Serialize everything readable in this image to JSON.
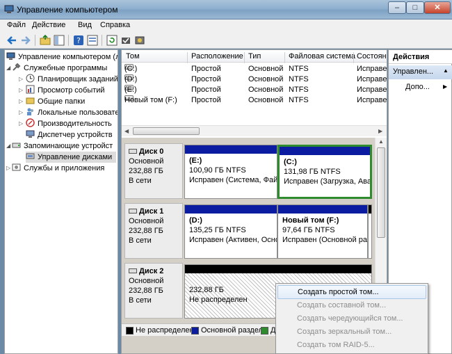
{
  "window": {
    "title": "Управление компьютером"
  },
  "menu": [
    "Файл",
    "Действие",
    "Вид",
    "Справка"
  ],
  "tree": [
    {
      "label": "Управление компьютером (л",
      "level": 0
    },
    {
      "label": "Служебные программы",
      "level": 1
    },
    {
      "label": "Планировщик заданий",
      "level": 2
    },
    {
      "label": "Просмотр событий",
      "level": 2
    },
    {
      "label": "Общие папки",
      "level": 2
    },
    {
      "label": "Локальные пользовате",
      "level": 2
    },
    {
      "label": "Производительность",
      "level": 2
    },
    {
      "label": "Диспетчер устройств",
      "level": 2
    },
    {
      "label": "Запоминающие устройст",
      "level": 1
    },
    {
      "label": "Управление дисками",
      "level": 2
    },
    {
      "label": "Службы и приложения",
      "level": 1
    }
  ],
  "volumes": {
    "headers": [
      "Том",
      "Расположение",
      "Тип",
      "Файловая система",
      "Состоян"
    ],
    "rows": [
      [
        "(C:)",
        "Простой",
        "Основной",
        "NTFS",
        "Исправе"
      ],
      [
        "(D:)",
        "Простой",
        "Основной",
        "NTFS",
        "Исправе"
      ],
      [
        "(E:)",
        "Простой",
        "Основной",
        "NTFS",
        "Исправе"
      ],
      [
        "Новый том (F:)",
        "Простой",
        "Основной",
        "NTFS",
        "Исправе"
      ]
    ]
  },
  "disks": [
    {
      "name": "Диск 0",
      "type": "Основной",
      "size": "232,88 ГБ",
      "status": "В сети",
      "partitions": [
        {
          "name": "(E:)",
          "size": "100,90 ГБ NTFS",
          "status": "Исправен (Система, Фай"
        },
        {
          "name": "(C:)",
          "size": "131,98 ГБ NTFS",
          "status": "Исправен (Загрузка, Ава"
        }
      ]
    },
    {
      "name": "Диск 1",
      "type": "Основной",
      "size": "232,88 ГБ",
      "status": "В сети",
      "partitions": [
        {
          "name": "(D:)",
          "size": "135,25 ГБ NTFS",
          "status": "Исправен (Активен, Осно"
        },
        {
          "name": "Новый том  (F:)",
          "size": "97,64 ГБ NTFS",
          "status": "Исправен (Основной ра"
        }
      ]
    },
    {
      "name": "Диск 2",
      "type": "Основной",
      "size": "232,88 ГБ",
      "status": "В сети",
      "partitions": [
        {
          "name": "232,88 ГБ",
          "size": "",
          "status": "Не распределен"
        }
      ]
    }
  ],
  "legend": [
    {
      "label": "Не распределен",
      "color": "#000000"
    },
    {
      "label": "Основной раздел",
      "color": "#0b1ca1"
    },
    {
      "label": "Д",
      "color": "#2e8b2e"
    }
  ],
  "actions": {
    "title": "Действия",
    "section": "Управлен...",
    "more": "Допо..."
  },
  "context_menu": [
    {
      "label": "Создать простой том...",
      "enabled": true
    },
    {
      "label": "Создать составной том...",
      "enabled": false
    },
    {
      "label": "Создать чередующийся том...",
      "enabled": false
    },
    {
      "label": "Создать зеркальный том...",
      "enabled": false
    },
    {
      "label": "Создать том RAID-5...",
      "enabled": false
    }
  ]
}
